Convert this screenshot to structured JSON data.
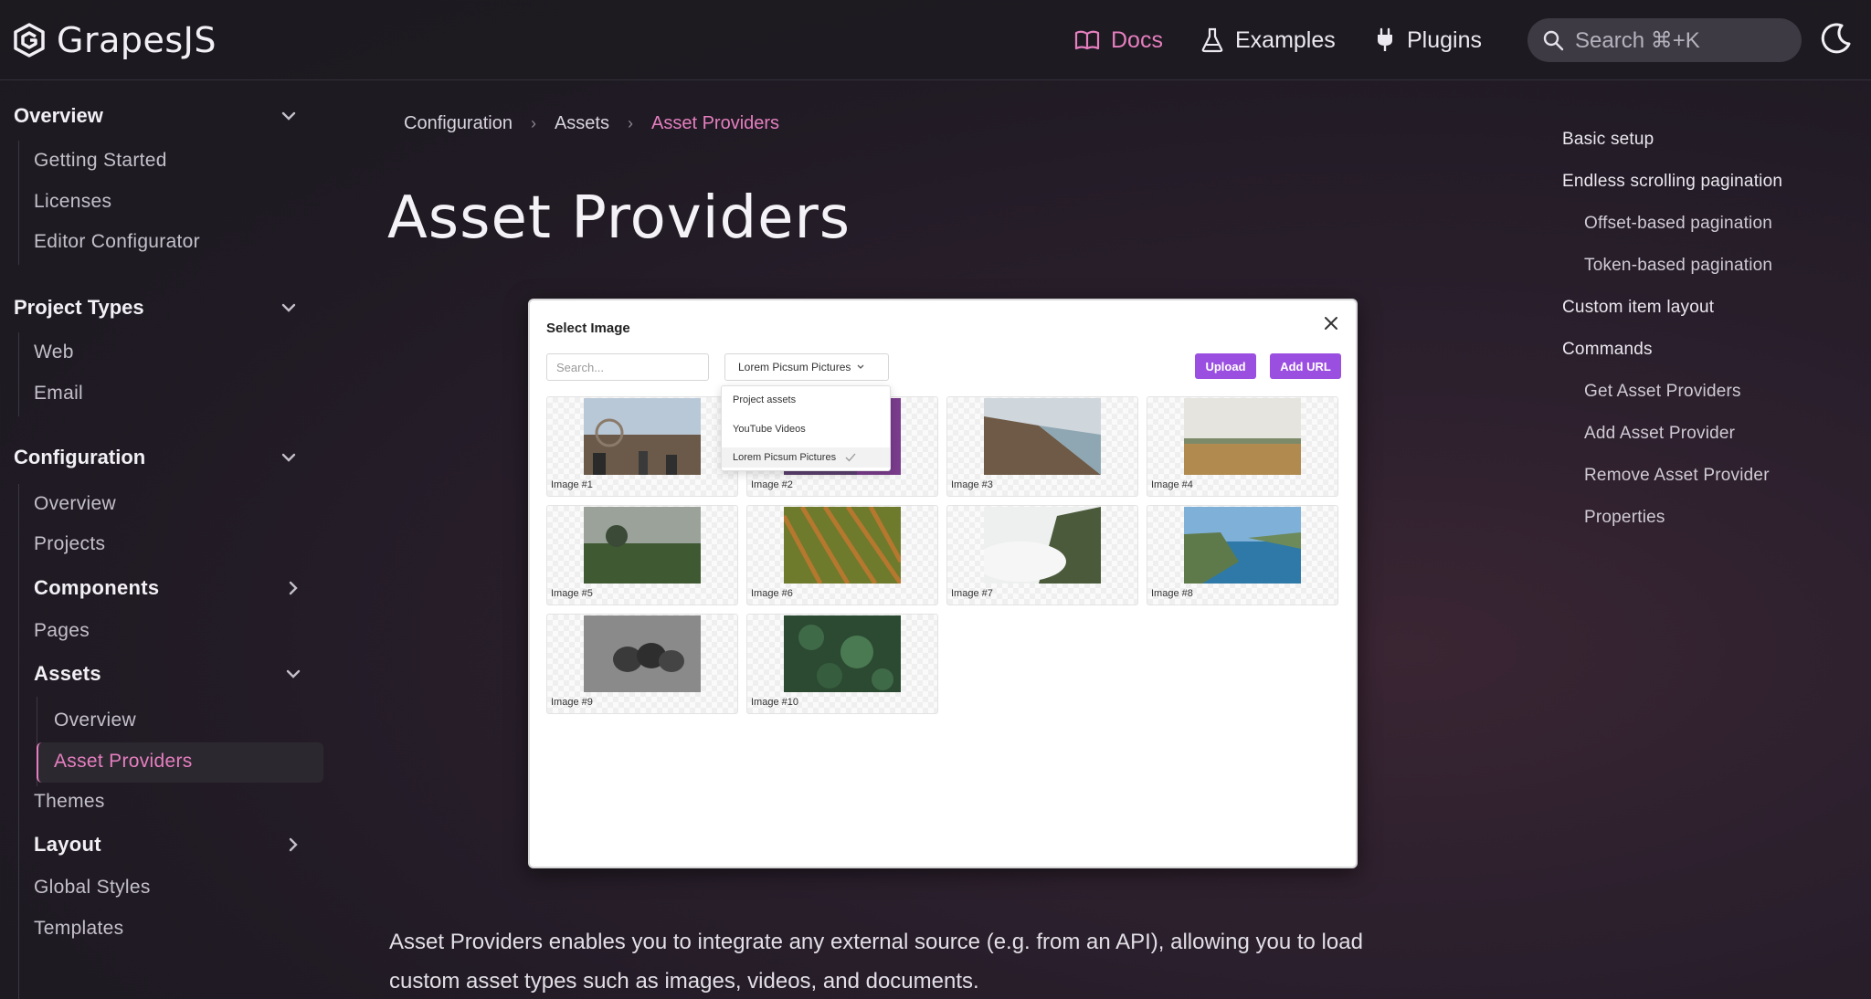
{
  "brand": {
    "name": "GrapesJS"
  },
  "nav": {
    "docs": "Docs",
    "examples": "Examples",
    "plugins": "Plugins",
    "search_placeholder": "Search ⌘+K"
  },
  "sidebar": {
    "overview": {
      "title": "Overview",
      "items": [
        "Getting Started",
        "Licenses",
        "Editor Configurator"
      ]
    },
    "project_types": {
      "title": "Project Types",
      "items": [
        "Web",
        "Email"
      ]
    },
    "configuration": {
      "title": "Configuration",
      "items": [
        "Overview",
        "Projects",
        "Components",
        "Pages",
        "Assets",
        "Themes",
        "Layout",
        "Global Styles",
        "Templates"
      ],
      "assets_children": [
        "Overview",
        "Asset Providers"
      ]
    }
  },
  "breadcrumb": [
    "Configuration",
    "Assets",
    "Asset Providers"
  ],
  "page": {
    "title": "Asset Providers",
    "description_line1": "Asset Providers enables you to integrate any external source (e.g. from an API), allowing you to load",
    "description_line2": "custom asset types such as images, videos, and documents."
  },
  "modal": {
    "title": "Select Image",
    "search_placeholder": "Search...",
    "select_value": "Lorem Picsum Pictures",
    "upload_label": "Upload",
    "add_url_label": "Add URL",
    "dropdown_options": [
      "Project assets",
      "YouTube Videos",
      "Lorem Picsum Pictures"
    ],
    "images": [
      "Image #1",
      "Image #2",
      "Image #3",
      "Image #4",
      "Image #5",
      "Image #6",
      "Image #7",
      "Image #8",
      "Image #9",
      "Image #10"
    ]
  },
  "toc": {
    "items": [
      "Basic setup",
      "Endless scrolling pagination",
      "Offset-based pagination",
      "Token-based pagination",
      "Custom item layout",
      "Commands",
      "Get Asset Providers",
      "Add Asset Provider",
      "Remove Asset Provider",
      "Properties"
    ]
  },
  "colors": {
    "accent": "#e57fbf",
    "button": "#9b4fe0"
  }
}
